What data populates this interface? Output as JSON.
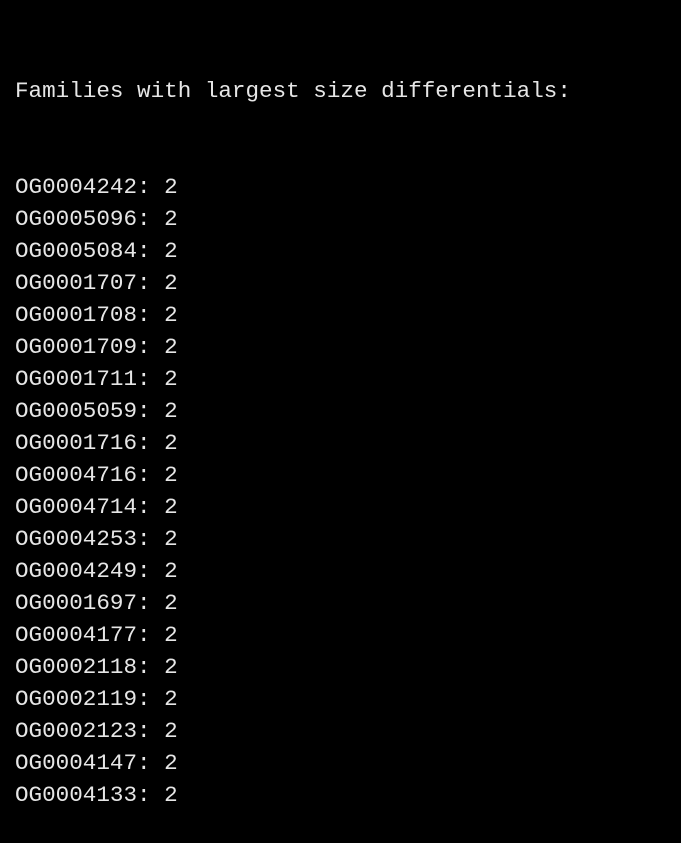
{
  "terminal": {
    "heading": "Families with largest size differentials:",
    "separator": ": ",
    "entries": [
      {
        "family": "OG0004242",
        "value": "2"
      },
      {
        "family": "OG0005096",
        "value": "2"
      },
      {
        "family": "OG0005084",
        "value": "2"
      },
      {
        "family": "OG0001707",
        "value": "2"
      },
      {
        "family": "OG0001708",
        "value": "2"
      },
      {
        "family": "OG0001709",
        "value": "2"
      },
      {
        "family": "OG0001711",
        "value": "2"
      },
      {
        "family": "OG0005059",
        "value": "2"
      },
      {
        "family": "OG0001716",
        "value": "2"
      },
      {
        "family": "OG0004716",
        "value": "2"
      },
      {
        "family": "OG0004714",
        "value": "2"
      },
      {
        "family": "OG0004253",
        "value": "2"
      },
      {
        "family": "OG0004249",
        "value": "2"
      },
      {
        "family": "OG0001697",
        "value": "2"
      },
      {
        "family": "OG0004177",
        "value": "2"
      },
      {
        "family": "OG0002118",
        "value": "2"
      },
      {
        "family": "OG0002119",
        "value": "2"
      },
      {
        "family": "OG0002123",
        "value": "2"
      },
      {
        "family": "OG0004147",
        "value": "2"
      },
      {
        "family": "OG0004133",
        "value": "2"
      }
    ]
  },
  "colors": {
    "background": "#000000",
    "text": "#e6e6e6"
  }
}
